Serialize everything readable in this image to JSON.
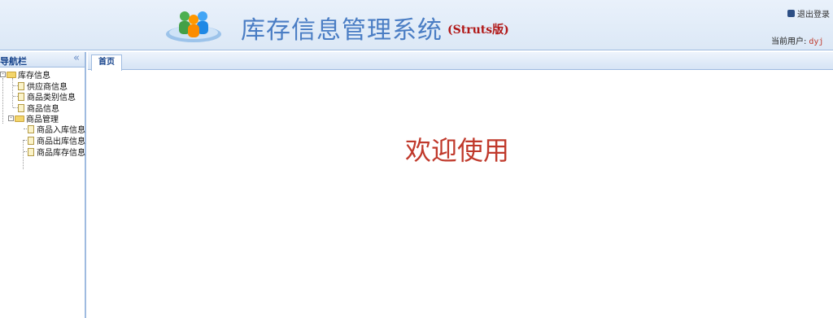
{
  "header": {
    "title": "库存信息管理系统",
    "subtitle": "(Struts版)",
    "logout_label": "退出登录",
    "current_user_label": "当前用户:",
    "current_user": "dyj"
  },
  "sidebar": {
    "title": "导航栏",
    "collapse_icon": "«",
    "tree": {
      "group1": {
        "label": "库存信息",
        "toggle": "-"
      },
      "item_supplier": "供应商信息",
      "item_category": "商品类别信息",
      "item_goods": "商品信息",
      "group2": {
        "label": "商品管理",
        "toggle": "-"
      },
      "item_in": "商品入库信息",
      "item_out": "商品出库信息",
      "item_stock": "商品库存信息"
    }
  },
  "main": {
    "tab_label": "首页",
    "welcome": "欢迎使用"
  },
  "colors": {
    "accent": "#4a7dc4",
    "welcome": "#c0392b",
    "border": "#9fbbe0"
  }
}
